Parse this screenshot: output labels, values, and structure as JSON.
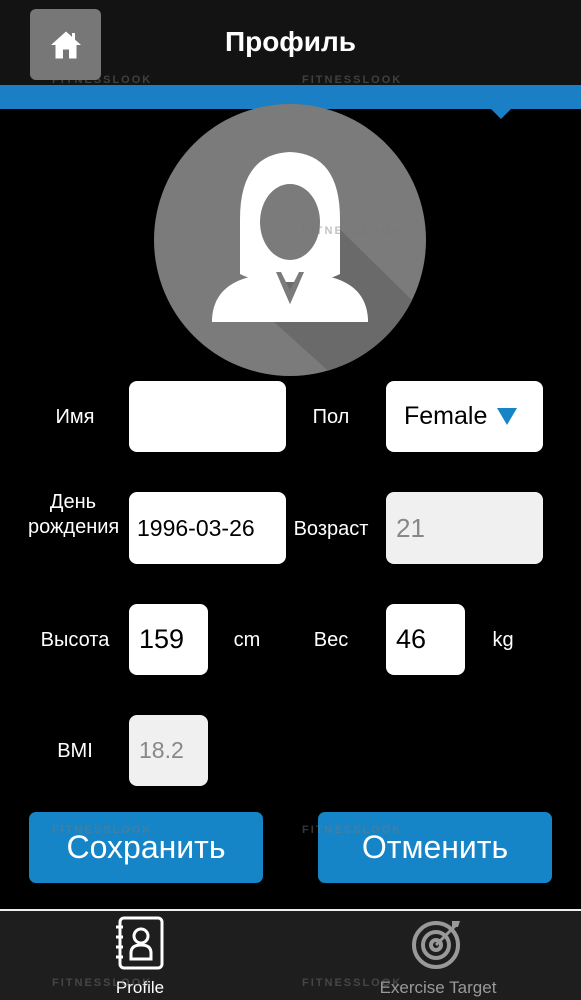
{
  "header": {
    "title": "Профиль",
    "home_icon": "home-icon"
  },
  "watermark": "FITNESSLOOK",
  "form": {
    "name": {
      "label": "Имя",
      "value": ""
    },
    "gender": {
      "label": "Пол",
      "value": "Female"
    },
    "birthday": {
      "label": "День рождения",
      "value": "1996-03-26"
    },
    "age": {
      "label": "Возраст",
      "value": "21"
    },
    "height": {
      "label": "Высота",
      "value": "159",
      "unit": "cm"
    },
    "weight": {
      "label": "Вес",
      "value": "46",
      "unit": "kg"
    },
    "bmi": {
      "label": "BMI",
      "value": "18.2"
    }
  },
  "buttons": {
    "save": "Сохранить",
    "cancel": "Отменить"
  },
  "tabs": [
    {
      "label": "Profile",
      "icon": "address-book-icon",
      "active": true
    },
    {
      "label": "Exercise Target",
      "icon": "target-icon",
      "active": false
    }
  ],
  "colors": {
    "accent": "#1a7fc4",
    "button": "#1585c8"
  }
}
